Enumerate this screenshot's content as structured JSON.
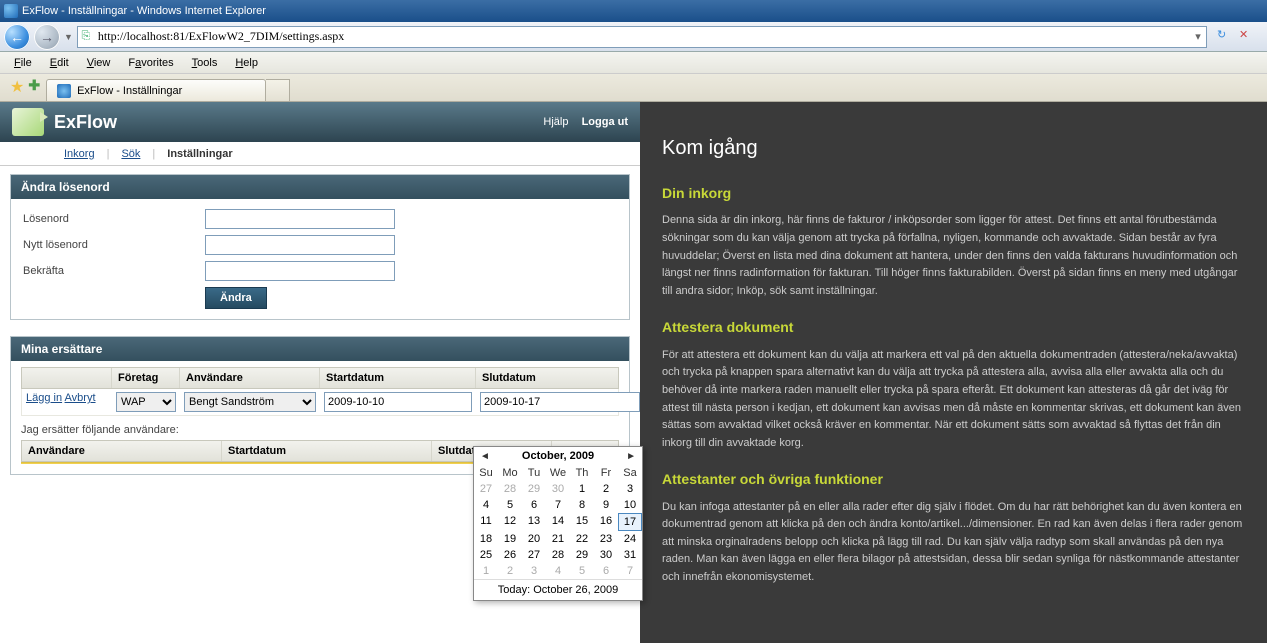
{
  "browser": {
    "title": "ExFlow - Inställningar - Windows Internet Explorer",
    "url": "http://localhost:81/ExFlowW2_7DIM/settings.aspx",
    "menu": [
      "File",
      "Edit",
      "View",
      "Favorites",
      "Tools",
      "Help"
    ],
    "tab_title": "ExFlow - Inställningar"
  },
  "app": {
    "title": "ExFlow",
    "help": "Hjälp",
    "logout": "Logga ut",
    "nav": {
      "inkorg": "Inkorg",
      "sok": "Sök",
      "installningar": "Inställningar"
    }
  },
  "password_panel": {
    "title": "Ändra lösenord",
    "pw": "Lösenord",
    "newpw": "Nytt lösenord",
    "confirm": "Bekräfta",
    "button": "Ändra"
  },
  "replace_panel": {
    "title": "Mina ersättare",
    "cols": {
      "c0": "",
      "c1": "Företag",
      "c2": "Användare",
      "c3": "Startdatum",
      "c4": "Slutdatum"
    },
    "row": {
      "add": "Lägg in",
      "cancel": "Avbryt",
      "company": "WAP",
      "user": "Bengt Sandström",
      "start": "2009-10-10",
      "end": "2009-10-17"
    },
    "subtext": "Jag ersätter följande användare:",
    "cols2": {
      "user": "Användare",
      "start": "Startdatum",
      "end": "Slutdatum"
    }
  },
  "calendar": {
    "title": "October, 2009",
    "dow": [
      "Su",
      "Mo",
      "Tu",
      "We",
      "Th",
      "Fr",
      "Sa"
    ],
    "footer": "Today: October 26, 2009",
    "selected": 17
  },
  "help": {
    "h1": "Kom igång",
    "s1t": "Din inkorg",
    "s1p": "Denna sida är din inkorg, här finns de fakturor / inköpsorder som ligger för attest. Det finns ett antal förutbestämda sökningar som du kan välja genom att trycka på förfallna, nyligen, kommande och avvaktade. Sidan består av fyra huvuddelar; Överst en lista med dina dokument att hantera, under den finns den valda fakturans huvudinformation och längst ner finns radinformation för fakturan. Till höger finns fakturabilden. Överst på sidan finns en meny med utgångar till andra sidor; Inköp, sök samt inställningar.",
    "s2t": "Attestera dokument",
    "s2p": "För att attestera ett dokument kan du välja att markera ett val på den aktuella dokumentraden (attestera/neka/avvakta) och trycka på knappen spara alternativt kan du välja att trycka på attestera alla, avvisa alla eller avvakta alla och du behöver då inte markera raden manuellt eller trycka på spara efteråt. Ett dokument kan attesteras då går det iväg för attest till nästa person i kedjan, ett dokument kan avvisas men då måste en kommentar skrivas, ett dokument kan även sättas som avvaktad vilket också kräver en kommentar. När ett dokument sätts som avvaktad så flyttas det från din inkorg till din avvaktade korg.",
    "s3t": "Attestanter och övriga funktioner",
    "s3p": "Du kan infoga attestanter på en eller alla rader efter dig själv i flödet. Om du har rätt behörighet kan du även kontera en dokumentrad genom att klicka på den och ändra konto/artikel.../dimensioner. En rad kan även delas i flera rader genom att minska orginalradens belopp och klicka på lägg till rad. Du kan själv välja radtyp som skall användas på den nya raden. Man kan även lägga en eller flera bilagor på attestsidan, dessa blir sedan synliga för nästkommande attestanter och innefrån ekonomisystemet."
  }
}
